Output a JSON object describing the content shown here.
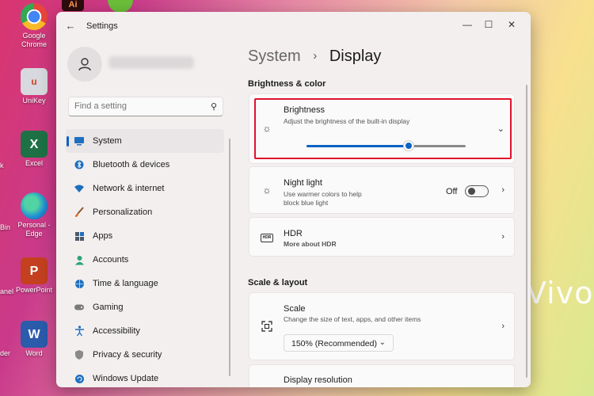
{
  "desktop": {
    "icons": [
      {
        "label": "Google Chrome",
        "glyph": "◉",
        "color": "#e8453c"
      },
      {
        "label": "UniKey",
        "glyph": "u",
        "color": "#c9cbd2"
      },
      {
        "label": "Excel",
        "glyph": "X",
        "color": "#1e7145"
      },
      {
        "label": "Personal - Edge",
        "glyph": "e",
        "color": "#1f8fd6"
      },
      {
        "label": "PowerPoint",
        "glyph": "P",
        "color": "#c4401f"
      },
      {
        "label": "Word",
        "glyph": "W",
        "color": "#2b5cab"
      }
    ],
    "edge_labels": [
      "k",
      "Bin",
      "anel",
      "der"
    ],
    "watermark": "VivoB"
  },
  "window": {
    "title": "Settings",
    "controls": {
      "minimize": "—",
      "maximize": "☐",
      "close": "✕"
    }
  },
  "sidebar": {
    "search_placeholder": "Find a setting",
    "items": [
      {
        "label": "System",
        "icon": "monitor-icon",
        "glyph": "▬",
        "color": "#1d6fbf"
      },
      {
        "label": "Bluetooth & devices",
        "icon": "bluetooth-icon",
        "glyph": "ᛒ",
        "color": "#1d6fbf"
      },
      {
        "label": "Network & internet",
        "icon": "wifi-icon",
        "glyph": "◒",
        "color": "#1d6fbf"
      },
      {
        "label": "Personalization",
        "icon": "brush-icon",
        "glyph": "✎",
        "color": "#c9611a"
      },
      {
        "label": "Apps",
        "icon": "apps-icon",
        "glyph": "▦",
        "color": "#4a5a6a"
      },
      {
        "label": "Accounts",
        "icon": "person-icon",
        "glyph": "●",
        "color": "#2ea37a"
      },
      {
        "label": "Time & language",
        "icon": "globe-icon",
        "glyph": "◕",
        "color": "#1d6fbf"
      },
      {
        "label": "Gaming",
        "icon": "controller-icon",
        "glyph": "◖",
        "color": "#6a6a6a"
      },
      {
        "label": "Accessibility",
        "icon": "accessibility-icon",
        "glyph": "✱",
        "color": "#1d6fbf"
      },
      {
        "label": "Privacy & security",
        "icon": "shield-icon",
        "glyph": "⛊",
        "color": "#6a6a6a"
      },
      {
        "label": "Windows Update",
        "icon": "update-icon",
        "glyph": "↻",
        "color": "#1d6fbf"
      }
    ]
  },
  "main": {
    "breadcrumb": {
      "parent": "System",
      "current": "Display"
    },
    "sections": {
      "brightness_color": "Brightness & color",
      "scale_layout": "Scale & layout"
    },
    "brightness": {
      "title": "Brightness",
      "subtitle": "Adjust the brightness of the built-in display",
      "level": 0.64
    },
    "night_light": {
      "title": "Night light",
      "subtitle_line1": "Use warmer colors to help",
      "subtitle_line2": "block blue light",
      "state": "Off"
    },
    "hdr": {
      "title": "HDR",
      "link": "More about HDR",
      "icon_text": "HDR"
    },
    "scale": {
      "title": "Scale",
      "subtitle": "Change the size of text, apps, and other items",
      "value": "150% (Recommended)"
    },
    "display_resolution": {
      "title": "Display resolution"
    }
  },
  "colors": {
    "accent": "#0b63c4",
    "highlight_border": "#e0122b"
  }
}
